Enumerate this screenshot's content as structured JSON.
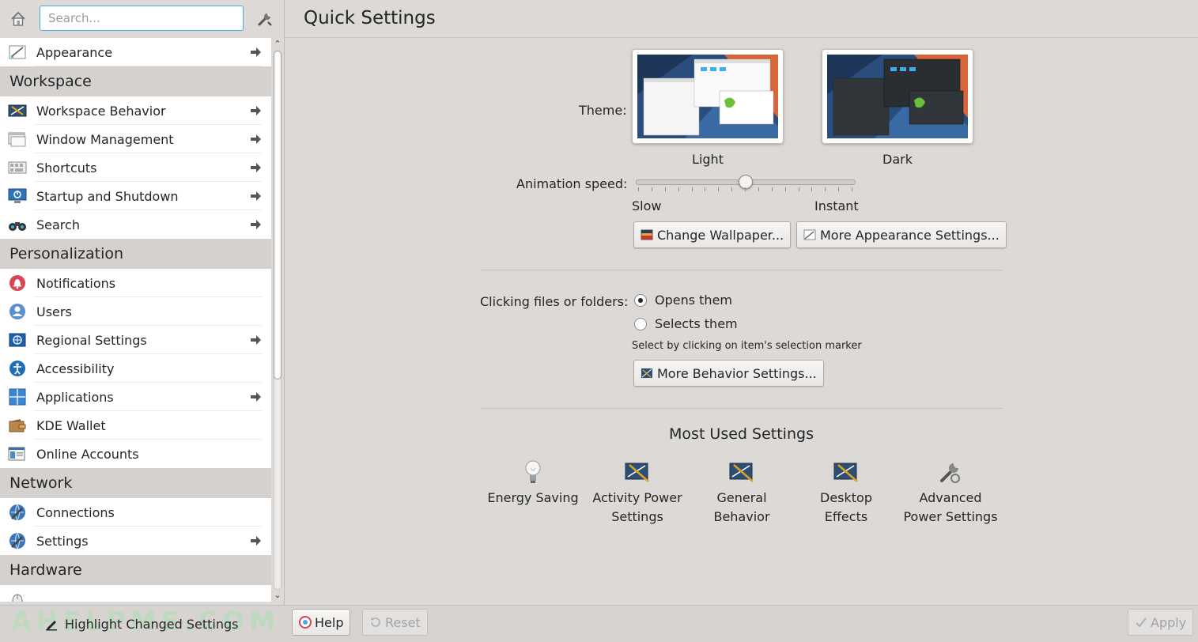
{
  "sidebar": {
    "search": {
      "placeholder": "Search...",
      "value": ""
    },
    "items": {
      "appearance": "Appearance",
      "workspace_behavior": "Workspace Behavior",
      "window_management": "Window Management",
      "shortcuts": "Shortcuts",
      "startup_shutdown": "Startup and Shutdown",
      "search": "Search",
      "notifications": "Notifications",
      "users": "Users",
      "regional_settings": "Regional Settings",
      "accessibility": "Accessibility",
      "applications": "Applications",
      "kde_wallet": "KDE Wallet",
      "online_accounts": "Online Accounts",
      "connections": "Connections",
      "network_settings": "Settings"
    },
    "categories": {
      "workspace": "Workspace",
      "personalization": "Personalization",
      "network": "Network",
      "hardware": "Hardware"
    }
  },
  "main": {
    "title": "Quick Settings",
    "theme_label": "Theme:",
    "themes": {
      "light": "Light",
      "dark": "Dark"
    },
    "animation_label": "Animation speed:",
    "animation_slow": "Slow",
    "animation_instant": "Instant",
    "animation_level": 0.5,
    "change_wallpaper": "Change Wallpaper...",
    "more_appearance": "More Appearance Settings...",
    "clicking_label": "Clicking files or folders:",
    "opens_them": "Opens them",
    "selects_them": "Selects them",
    "selects_hint": "Select by clicking on item's selection marker",
    "more_behavior": "More Behavior Settings...",
    "most_used_title": "Most Used Settings",
    "most_used": {
      "energy_line1": "Energy Saving",
      "energy_line2": "",
      "activity_line1": "Activity Power",
      "activity_line2": "Settings",
      "general_line1": "General",
      "general_line2": "Behavior",
      "desktop_line1": "Desktop",
      "desktop_line2": "Effects",
      "advanced_line1": "Advanced",
      "advanced_line2": "Power Settings"
    }
  },
  "bottom": {
    "watermark": "AHELPME.COM",
    "highlight": "Highlight Changed Settings",
    "help": "Help",
    "reset": "Reset",
    "apply": "Apply"
  },
  "colors": {
    "accent": "#3daee9",
    "background": "#dcd9d6",
    "list_bg": "#ffffff",
    "header_bg": "#d4d1cf"
  }
}
